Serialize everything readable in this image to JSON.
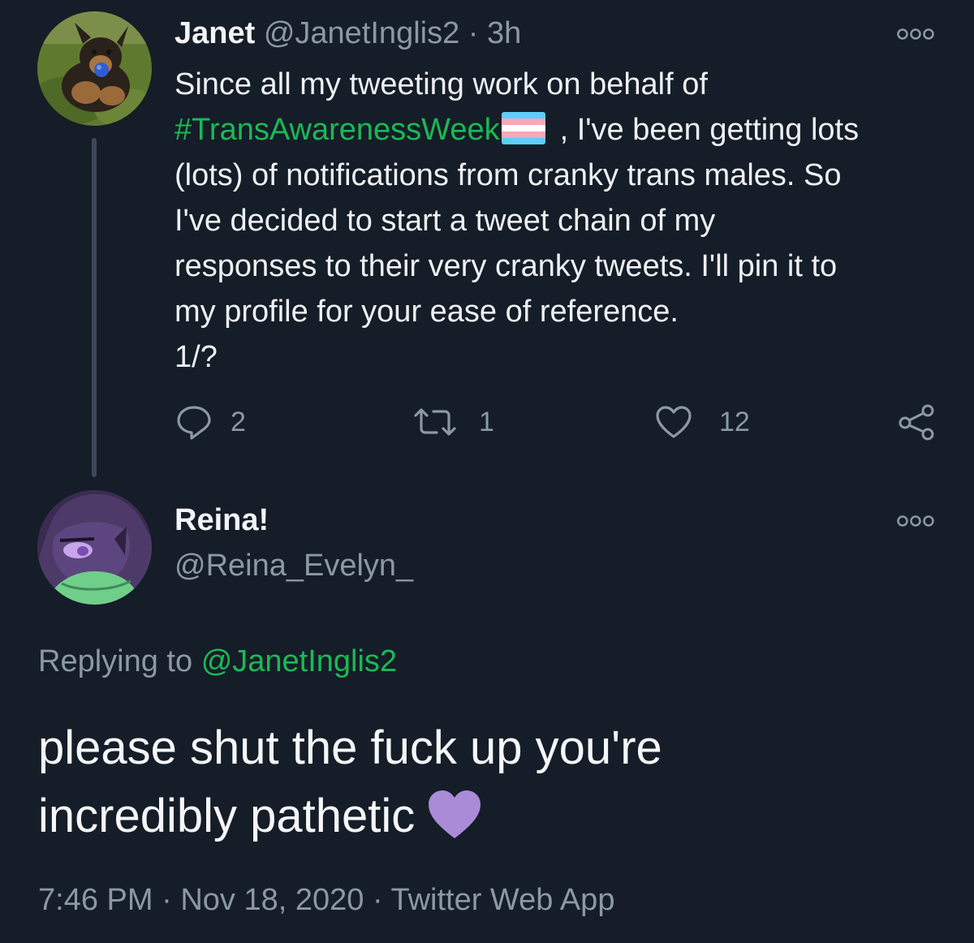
{
  "tweet": {
    "author_name": "Janet",
    "author_handle": "@JanetInglis2",
    "separator": "·",
    "time_ago": "3h",
    "text_line1": "Since all my tweeting work on behalf of",
    "hashtag": "#TransAwarenessWeek",
    "text_line2_rest": ", I've been getting lots",
    "text_line3": "(lots) of notifications from cranky trans males. So",
    "text_line4": "I've decided to start a tweet chain of my",
    "text_line5": "responses to their very cranky tweets. I'll pin it to",
    "text_line6": "my profile for your ease of reference.",
    "text_line7": "1/?",
    "flag_emoji_icon": "transgender-flag-icon",
    "reply_count": "2",
    "retweet_count": "1",
    "like_count": "12"
  },
  "reply": {
    "author_name": "Reina!",
    "author_handle": "@Reina_Evelyn_",
    "replying_prefix": "Replying to",
    "replying_to": "@JanetInglis2",
    "text_line1": "please shut the fuck up you're",
    "text_line2": "incredibly pathetic",
    "heart_emoji_icon": "purple-heart-icon",
    "time": "7:46 PM",
    "separator": "·",
    "date": "Nov 18, 2020",
    "source": "Twitter Web App"
  },
  "colors": {
    "background": "#151d28",
    "accent": "#1bb954",
    "muted": "#8b98a5",
    "purple_heart": "#a98bd8"
  }
}
